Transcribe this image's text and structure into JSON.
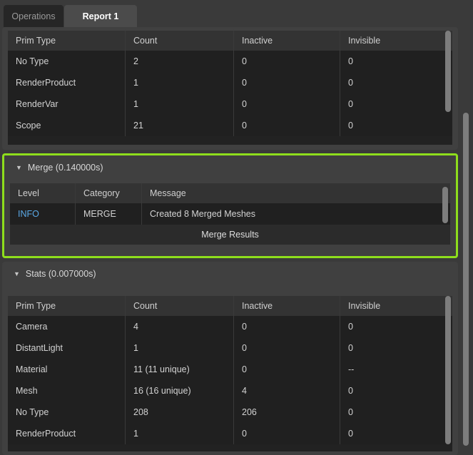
{
  "tabs": [
    {
      "label": "Operations",
      "active": false
    },
    {
      "label": "Report 1",
      "active": true
    }
  ],
  "colors": {
    "highlight_border": "#8ede1c",
    "info_level": "#5aa9e6",
    "panel_bg": "#404040",
    "table_bg": "#202020",
    "header_bg": "#333333"
  },
  "sections": [
    {
      "name": "top-stats",
      "title": null,
      "caret": "▼",
      "table": {
        "columns": [
          "Prim Type",
          "Count",
          "Inactive",
          "Invisible"
        ],
        "rows": [
          [
            "No Type",
            "2",
            "0",
            "0"
          ],
          [
            "RenderProduct",
            "1",
            "0",
            "0"
          ],
          [
            "RenderVar",
            "1",
            "0",
            "0"
          ],
          [
            "Scope",
            "21",
            "0",
            "0"
          ]
        ]
      }
    },
    {
      "name": "merge",
      "title": "Merge (0.140000s)",
      "caret": "▼",
      "highlighted": true,
      "table": {
        "columns": [
          "Level",
          "Category",
          "Message"
        ],
        "rows": [
          [
            "INFO",
            "MERGE",
            "Created 8 Merged Meshes"
          ]
        ],
        "footer": "Merge Results"
      }
    },
    {
      "name": "stats",
      "title": "Stats (0.007000s)",
      "caret": "▼",
      "table": {
        "columns": [
          "Prim Type",
          "Count",
          "Inactive",
          "Invisible"
        ],
        "rows": [
          [
            "Camera",
            "4",
            "0",
            "0"
          ],
          [
            "DistantLight",
            "1",
            "0",
            "0"
          ],
          [
            "Material",
            "11 (11 unique)",
            "0",
            "--"
          ],
          [
            "Mesh",
            "16 (16 unique)",
            "4",
            "0"
          ],
          [
            "No Type",
            "208",
            "206",
            "0"
          ],
          [
            "RenderProduct",
            "1",
            "0",
            "0"
          ]
        ]
      }
    }
  ],
  "scrollbars": {
    "outer": "vertical-scrollbar",
    "top_table": "vertical-scrollbar",
    "merge_table": "vertical-scrollbar",
    "stats_table": "vertical-scrollbar"
  }
}
